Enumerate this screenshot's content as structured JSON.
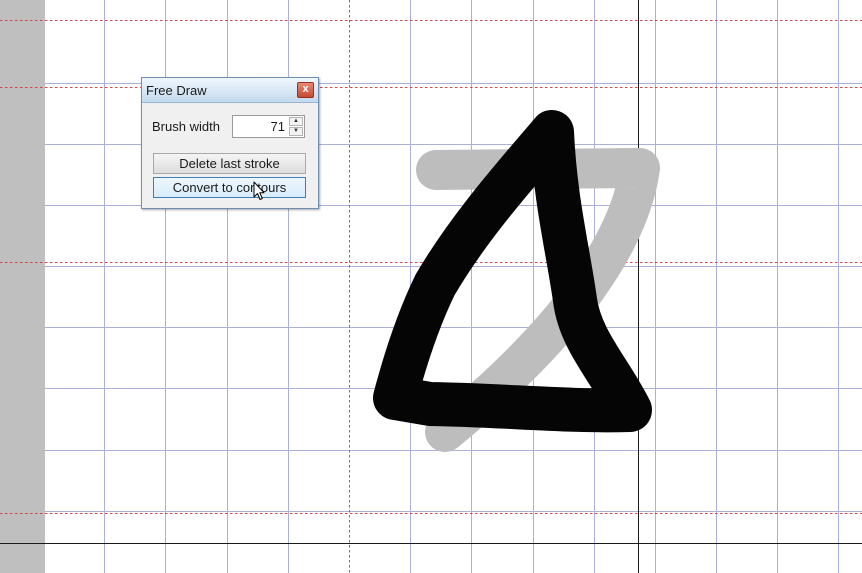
{
  "panel": {
    "title": "Free Draw",
    "close_glyph": "x",
    "brush_width_label": "Brush width",
    "brush_width_value": "71",
    "delete_button_label": "Delete last stroke",
    "convert_button_label": "Convert to contours"
  },
  "icons": {
    "close": "close-icon",
    "spin_up": "chevron-up-icon",
    "spin_down": "chevron-down-icon",
    "cursor": "mouse-pointer-icon"
  },
  "colors": {
    "grid_line": "#aab0da",
    "guide_line": "#d0474a",
    "stroke_black": "#050505",
    "stroke_gray": "#bdbdbd",
    "margin": "#bfbfbf"
  }
}
